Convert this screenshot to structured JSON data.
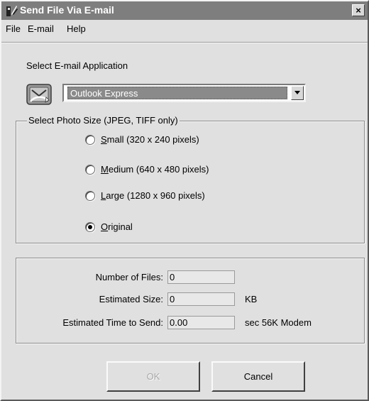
{
  "window": {
    "title": "Send File Via E-mail",
    "close_glyph": "×"
  },
  "menu": {
    "items": [
      "File",
      "E-mail",
      "Help"
    ]
  },
  "email_app": {
    "label": "Select E-mail Application",
    "selected": "Outlook Express",
    "icon": "email-application-icon"
  },
  "photo_size": {
    "title": "Select Photo Size (JPEG, TIFF only)",
    "options": [
      {
        "accel": "S",
        "rest": "mall (320 x 240 pixels)",
        "checked": false
      },
      {
        "accel": "M",
        "rest": "edium (640 x 480 pixels)",
        "checked": false
      },
      {
        "accel": "L",
        "rest": "arge (1280 x 960 pixels)",
        "checked": false
      },
      {
        "accel": "O",
        "rest": "riginal",
        "checked": true
      }
    ]
  },
  "stats": {
    "num_files_label": "Number of Files:",
    "num_files_value": "0",
    "est_size_label": "Estimated Size:",
    "est_size_value": "0",
    "est_size_unit": "KB",
    "est_time_label": "Estimated Time to Send:",
    "est_time_value": "0.00",
    "est_time_unit": "sec 56K Modem"
  },
  "buttons": {
    "ok": "OK",
    "cancel": "Cancel"
  },
  "colors": {
    "titlebar": "#7e7e7e",
    "dialog_bg": "#e0e0e0",
    "selection": "#8a8a8a"
  }
}
